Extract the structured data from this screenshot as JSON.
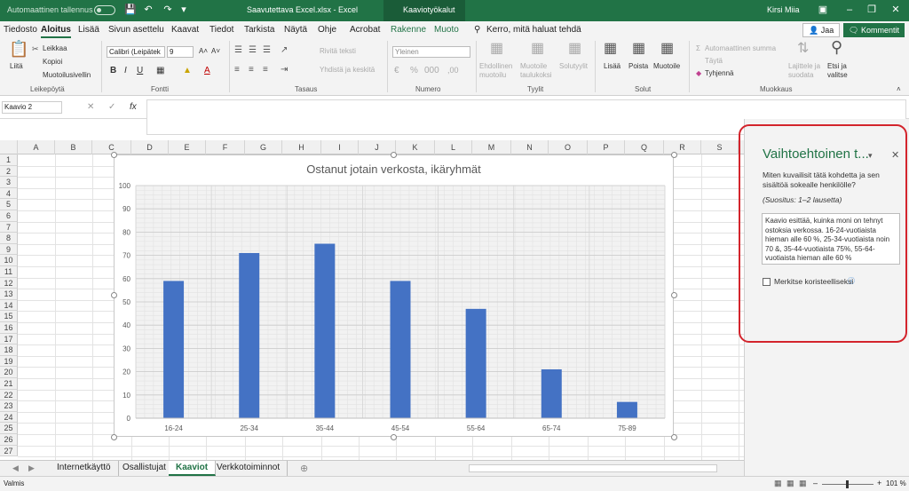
{
  "titlebar": {
    "autosave_label": "Automaattinen tallennus",
    "file_title": "Saavutettava Excel.xlsx  -  Excel",
    "context_tab": "Kaaviotyökalut",
    "user": "Kirsi Miia"
  },
  "menu": {
    "items": [
      "Tiedosto",
      "Aloitus",
      "Lisää",
      "Sivun asettelu",
      "Kaavat",
      "Tiedot",
      "Tarkista",
      "Näytä",
      "Ohje",
      "Acrobat",
      "Rakenne",
      "Muoto"
    ],
    "tellme": "Kerro, mitä haluat tehdä",
    "share": "Jaa",
    "comments": "Kommentit"
  },
  "ribbon": {
    "paste": "Liitä",
    "cut": "Leikkaa",
    "copy": "Kopioi",
    "format_painter": "Muotoilusivellin",
    "clipboard_group": "Leikepöytä",
    "font_name": "Calibri (Leipätek",
    "font_size": "9",
    "font_group": "Fontti",
    "wrap_text": "Rivitä teksti",
    "merge": "Yhdistä ja keskitä",
    "alignment_group": "Tasaus",
    "number_format": "Yleinen",
    "number_group": "Numero",
    "conditional": "Ehdollinen muotoilu",
    "format_table": "Muotoile taulukoksi",
    "cell_styles": "Solutyylit",
    "styles_group": "Tyylit",
    "insert": "Lisää",
    "delete": "Poista",
    "format": "Muotoile",
    "cells_group": "Solut",
    "autosum": "Automaattinen summa",
    "fill": "Täytä",
    "clear": "Tyhjennä",
    "sort_filter": "Lajittele ja suodata",
    "find_select": "Etsi ja valitse",
    "editing_group": "Muokkaus"
  },
  "formula_bar": {
    "name_box": "Kaavio 2",
    "fx": "fx"
  },
  "columns": [
    "A",
    "B",
    "C",
    "D",
    "E",
    "F",
    "G",
    "H",
    "I",
    "J",
    "K",
    "L",
    "M",
    "N",
    "O",
    "P",
    "Q",
    "R",
    "S"
  ],
  "rows": [
    "1",
    "2",
    "3",
    "4",
    "5",
    "6",
    "7",
    "8",
    "9",
    "10",
    "11",
    "12",
    "13",
    "14",
    "15",
    "16",
    "17",
    "18",
    "19",
    "20",
    "21",
    "22",
    "23",
    "24",
    "25",
    "26",
    "27"
  ],
  "chart_data": {
    "type": "bar",
    "title": "Ostanut jotain verkosta, ikäryhmät",
    "categories": [
      "16-24",
      "25-34",
      "35-44",
      "45-54",
      "55-64",
      "65-74",
      "75-89"
    ],
    "values": [
      59,
      71,
      75,
      59,
      47,
      21,
      7
    ],
    "ylim": [
      0,
      100
    ],
    "yticks": [
      "0",
      "10",
      "20",
      "30",
      "40",
      "50",
      "60",
      "70",
      "80",
      "90",
      "100"
    ],
    "bar_color": "#4472c4",
    "grid": true,
    "xlabel": "",
    "ylabel": ""
  },
  "sheet_tabs": [
    "Internetkäyttö",
    "Osallistujat",
    "Kaaviot",
    "Verkkotoiminnot"
  ],
  "active_sheet": "Kaaviot",
  "status": {
    "ready": "Valmis",
    "zoom": "101 %"
  },
  "alt_text_pane": {
    "title": "Vaihtoehtoinen t...",
    "question": "Miten kuvailisit tätä kohdetta ja sen sisältöä sokealle henkilölle?",
    "hint": "(Suositus: 1–2 lausetta)",
    "text": "Kaavio esittää, kuinka moni on tehnyt ostoksia verkossa. 16-24-vuotiaista hieman alle 60 %, 25-34-vuotiaista noin 70 &, 35-44-vuotiaista 75%, 55-64-vuotiaista hieman alle 60 %",
    "decorative_label": "Merkitse koristeelliseksi"
  },
  "colors": {
    "excel_green": "#217346",
    "highlight_red": "#d3242c"
  }
}
